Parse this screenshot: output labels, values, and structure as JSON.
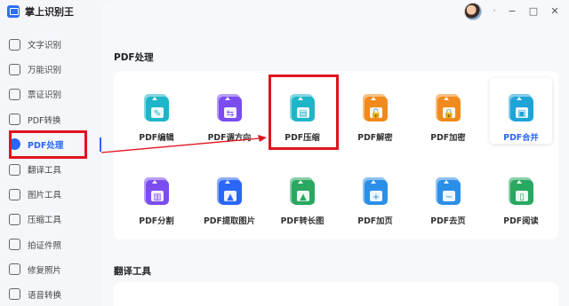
{
  "app": {
    "title": "掌上识别王"
  },
  "window_controls": {
    "dot": "·",
    "minimize": "−",
    "maximize": "□",
    "close": "✕"
  },
  "sidebar": {
    "items": [
      {
        "label": "文字识别",
        "icon": "text-scan-icon"
      },
      {
        "label": "万能识别",
        "icon": "universal-scan-icon"
      },
      {
        "label": "票证识别",
        "icon": "ticket-icon"
      },
      {
        "label": "PDF转换",
        "icon": "pdf-convert-icon"
      },
      {
        "label": "PDF处理",
        "icon": "pdf-process-icon",
        "active": true
      },
      {
        "label": "翻译工具",
        "icon": "translate-icon"
      },
      {
        "label": "图片工具",
        "icon": "image-icon"
      },
      {
        "label": "压缩工具",
        "icon": "compress-icon"
      },
      {
        "label": "拍证件照",
        "icon": "id-photo-icon"
      },
      {
        "label": "修复照片",
        "icon": "repair-photo-icon"
      },
      {
        "label": "语音转换",
        "icon": "voice-icon"
      }
    ]
  },
  "main": {
    "section1_title": "PDF处理",
    "section2_title": "翻译工具",
    "tools": [
      {
        "label": "PDF编辑",
        "color": "#1fb5c9",
        "glyph": "✎"
      },
      {
        "label": "PDF调方向",
        "color": "#7b4cf0",
        "glyph": "⇆"
      },
      {
        "label": "PDF压缩",
        "color": "#1fb5c9",
        "glyph": "▤"
      },
      {
        "label": "PDF解密",
        "color": "#f08a1c",
        "glyph": "🔓"
      },
      {
        "label": "PDF加密",
        "color": "#f08a1c",
        "glyph": "🔒"
      },
      {
        "label": "PDF合并",
        "color": "#1fa4d8",
        "glyph": "▣",
        "selected": true
      },
      {
        "label": "PDF分割",
        "color": "#7b4cf0",
        "glyph": "▥"
      },
      {
        "label": "PDF提取图片",
        "color": "#2b67f6",
        "glyph": "▲"
      },
      {
        "label": "PDF转长图",
        "color": "#28a860",
        "glyph": "▲"
      },
      {
        "label": "PDF加页",
        "color": "#2b8fe8",
        "glyph": "+"
      },
      {
        "label": "PDF去页",
        "color": "#2b8fe8",
        "glyph": "−"
      },
      {
        "label": "PDF阅读",
        "color": "#28a860",
        "glyph": "▯"
      }
    ]
  },
  "accent_color": "#2b67f6",
  "highlight_color": "#e0141e"
}
